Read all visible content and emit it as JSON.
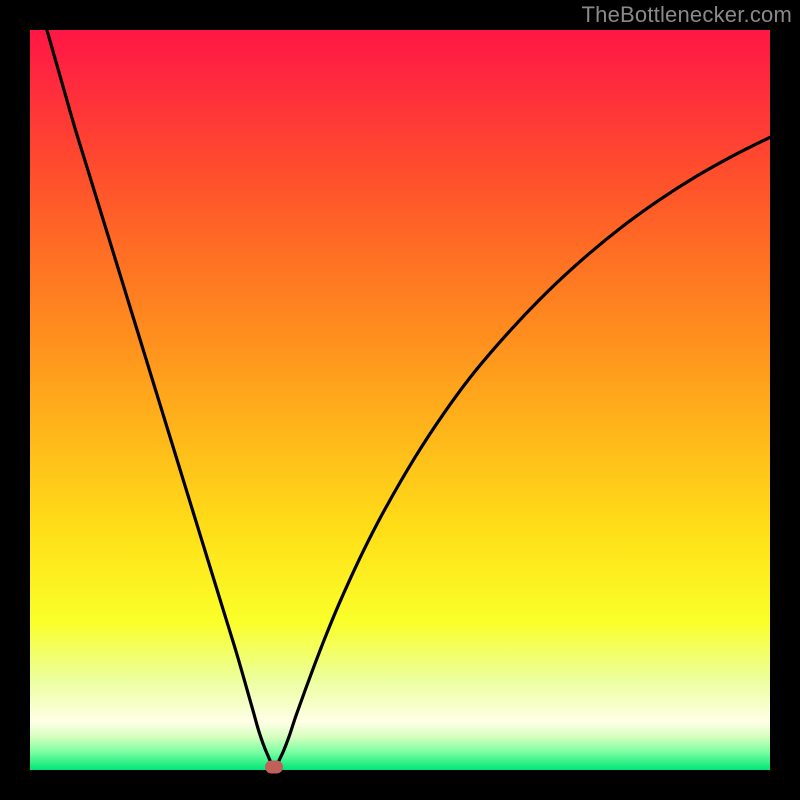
{
  "watermark": {
    "text": "TheBottlenecker.com"
  },
  "colors": {
    "frame_border": "#000000",
    "curve_stroke": "#000000",
    "marker_fill": "#c06058",
    "gradient_stops": [
      {
        "offset": 0.0,
        "color": "#ff1744"
      },
      {
        "offset": 0.07,
        "color": "#ff2a3e"
      },
      {
        "offset": 0.18,
        "color": "#ff4a2e"
      },
      {
        "offset": 0.3,
        "color": "#ff6e24"
      },
      {
        "offset": 0.42,
        "color": "#ff901e"
      },
      {
        "offset": 0.55,
        "color": "#ffb81a"
      },
      {
        "offset": 0.68,
        "color": "#ffe018"
      },
      {
        "offset": 0.8,
        "color": "#faff2a"
      },
      {
        "offset": 0.88,
        "color": "#ecffa0"
      },
      {
        "offset": 0.935,
        "color": "#ffffe6"
      },
      {
        "offset": 0.955,
        "color": "#d6ffbe"
      },
      {
        "offset": 0.975,
        "color": "#7dffa4"
      },
      {
        "offset": 1.0,
        "color": "#00e676"
      }
    ]
  },
  "chart_data": {
    "type": "line",
    "title": "",
    "xlabel": "",
    "ylabel": "",
    "xlim": [
      0,
      100
    ],
    "ylim": [
      0,
      100
    ],
    "grid": false,
    "legend": false,
    "min_point": {
      "x": 33,
      "y": 0
    },
    "series": [
      {
        "name": "curve",
        "x": [
          0,
          2,
          4,
          6,
          8,
          10,
          12,
          14,
          16,
          18,
          20,
          22,
          24,
          26,
          28,
          30,
          31,
          32,
          33,
          34,
          35,
          36,
          38,
          40,
          42,
          45,
          48,
          52,
          56,
          60,
          65,
          70,
          75,
          80,
          85,
          90,
          95,
          100
        ],
        "y": [
          108,
          101,
          94,
          87,
          80.5,
          74,
          67.5,
          61,
          54.5,
          48,
          41.5,
          35,
          28.5,
          22,
          15.5,
          8.5,
          5.0,
          2.3,
          0.5,
          2.0,
          4.5,
          7.5,
          13.0,
          18.2,
          23.0,
          29.5,
          35.3,
          42.2,
          48.3,
          53.7,
          59.5,
          64.7,
          69.3,
          73.4,
          77.0,
          80.2,
          83.0,
          85.5
        ]
      }
    ]
  }
}
